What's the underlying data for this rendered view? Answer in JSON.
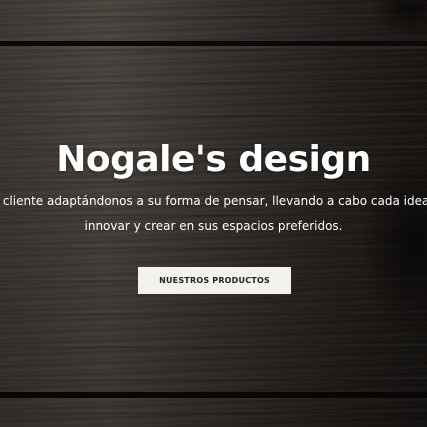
{
  "hero": {
    "title": "Nogale's design",
    "description_line1": "ada cliente adaptándonos a su forma de pensar, llevando a cabo cada idea y s",
    "description_line2": "innovar y crear en sus espacios preferidos.",
    "cta_label": "NUESTROS PRODUCTOS"
  },
  "colors": {
    "text": "#ffffff",
    "button_bg": "#f4f2ee",
    "button_text": "#222222",
    "wood_dark": "#1d1916",
    "wood_light": "#5a524c"
  }
}
